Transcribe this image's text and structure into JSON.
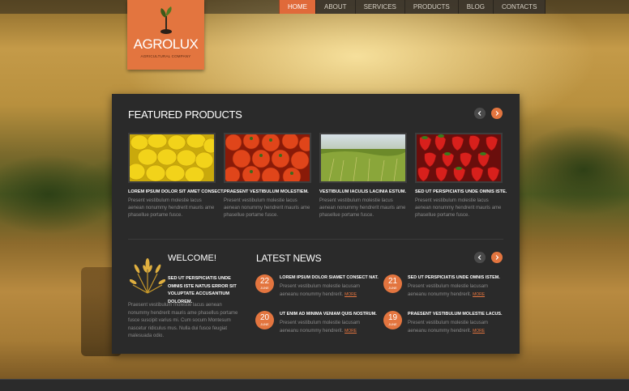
{
  "nav": {
    "items": [
      {
        "label": "HOME",
        "active": true
      },
      {
        "label": "ABOUT",
        "active": false
      },
      {
        "label": "SERVICES",
        "active": false
      },
      {
        "label": "PRODUCTS",
        "active": false
      },
      {
        "label": "BLOG",
        "active": false
      },
      {
        "label": "CONTACTS",
        "active": false
      }
    ]
  },
  "logo": {
    "title": "AGROLUX",
    "subtitle": "AGRICULTURAL COMPANY",
    "icon": "sprout-icon"
  },
  "colors": {
    "accent": "#e3753f",
    "panel": "#2a2a2a",
    "muted_text": "#8a8a8a"
  },
  "featured": {
    "title": "FEATURED PRODUCTS",
    "products": [
      {
        "image": "lemons",
        "title": "LOREM IPSUM DOLOR SIT AMET CONSECT.",
        "text": "Present vestibulum molestie lacus aenean nonummy hendrerit mauris ame phasellue portame fusce."
      },
      {
        "image": "tomatoes",
        "title": "PRAESENT VESTIBULUM MOLESTIEM.",
        "text": "Present vestibulum molestie lacus aenean nonummy hendrerit mauris ame phasellue portame fusce."
      },
      {
        "image": "wheat-field",
        "title": "VESTIBULUM IACULIS LACINIA ESTUM.",
        "text": "Present vestibulum molestie lacus aenean nonummy hendrerit mauris ame phasellue portame fusce."
      },
      {
        "image": "strawberries",
        "title": "SED UT PERSPICIATIS UNDE OMNIS ISTE.",
        "text": "Present vestibulum molestie lacus aenean nonummy hendrerit mauris ame phasellue portame fusce."
      }
    ]
  },
  "welcome": {
    "title": "WELCOME!",
    "lead": "SED UT PERSPICIATIS UNDE OMNIS ISTE NATUS ERROR SIT VOLUPTATE ACCUSANTIUM DOLOREM.",
    "text": "Praesent vestibulum molestie lacus aenean nonummy hendrerit mauris ame phasellus portame fusce suscipit varius mi. Cum socum Montesum nascetur ridiculus mus. Nulla dui fusce feugiat malesuada odio."
  },
  "news": {
    "title": "LATEST NEWS",
    "more_label": "MORE",
    "items": [
      {
        "day": "22",
        "month": "JUNE",
        "title": "LOREM IPSUM DOLOR SIAMET CONSECT NAT.",
        "text": "Present vestibulum molestie lacusam aeneanu nonummy hendrerit."
      },
      {
        "day": "21",
        "month": "JUNE",
        "title": "SED UT PERSPICIATIS UNDE OMNIS ISTEM.",
        "text": "Present vestibulum molestie lacusam aeneanu nonummy hendrerit."
      },
      {
        "day": "20",
        "month": "JUNE",
        "title": "UT ENIM AD MINIMA VENIAM QUIS NOSTRUM.",
        "text": "Present vestibulum molestie lacusam aeneanu nonummy hendrerit."
      },
      {
        "day": "19",
        "month": "JUNE",
        "title": "PRAESENT VESTIBULUM MOLESTIE LACUS.",
        "text": "Present vestibulum molestie lacusam aeneanu nonummy hendrerit."
      }
    ]
  }
}
